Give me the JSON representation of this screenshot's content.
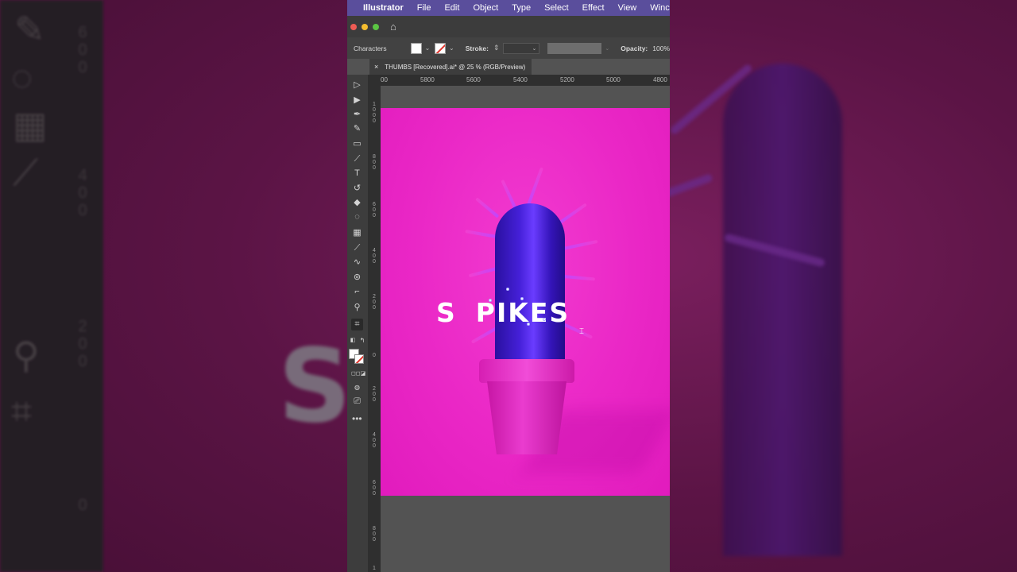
{
  "menubar": {
    "app_name": "Illustrator",
    "items": [
      "File",
      "Edit",
      "Object",
      "Type",
      "Select",
      "Effect",
      "View",
      "Winc"
    ]
  },
  "control_bar": {
    "context_label": "Characters",
    "stroke_label": "Stroke:",
    "opacity_label": "Opacity:",
    "opacity_value": "100%"
  },
  "document_tab": {
    "title": "THUMBS [Recovered].ai* @ 25 % (RGB/Preview)"
  },
  "ruler": {
    "top_ticks": [
      "00",
      "5800",
      "5600",
      "5400",
      "5200",
      "5000",
      "4800"
    ],
    "left_ticks": [
      "1\n0\n0\n0",
      "8\n0\n0",
      "6\n0\n0",
      "4\n0\n0",
      "2\n0\n0",
      "0",
      "2\n0\n0",
      "4\n0\n0",
      "6\n0\n0",
      "8\n0\n0",
      "1"
    ]
  },
  "artwork": {
    "text_left": "S",
    "text_right": "PIKES"
  },
  "background": {
    "blurred_text": "S  KES",
    "ghost_numbers": [
      "6\n0\n0",
      "4\n0\n0",
      "2\n0\n0",
      "0"
    ]
  },
  "colors": {
    "menubar": "#5a4e9c",
    "artboard_pink": "#ea27c6",
    "cactus_purple": "#4520d8"
  }
}
